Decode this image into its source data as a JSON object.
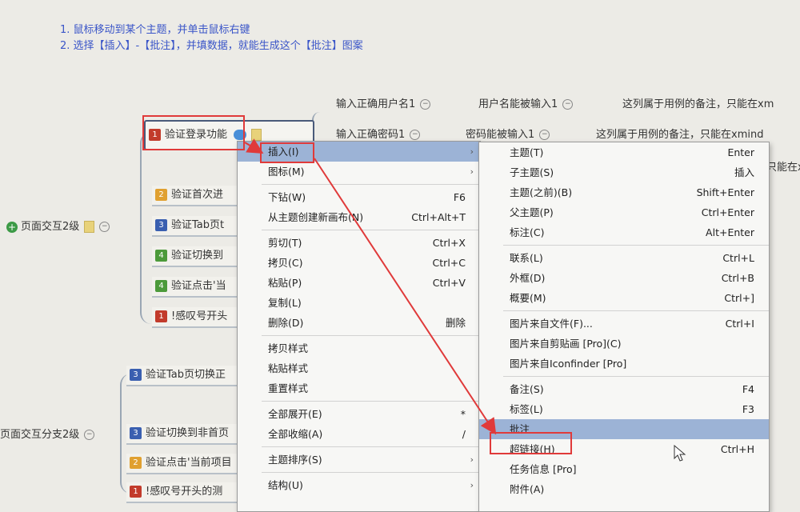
{
  "instructions": {
    "line1": "1. 鼠标移动到某个主题，并单击鼠标右键",
    "line2": "2. 选择【插入】-【批注】，并填数据，就能生成这个【批注】图案"
  },
  "mindmap": {
    "root1": "页面交互2级",
    "root2": "页面交互分支2级",
    "selected_topic": {
      "num": "1",
      "label": "验证登录功能"
    },
    "topics": [
      {
        "num": "2",
        "label": "验证首次进"
      },
      {
        "num": "3",
        "label": "验证Tab页t"
      },
      {
        "num": "4",
        "label": "验证切换到"
      },
      {
        "num": "4",
        "label": "验证点击'当"
      },
      {
        "num": "1",
        "label": "!感叹号开头"
      }
    ],
    "topics2": [
      {
        "num": "3",
        "label": "验证Tab页切换正"
      },
      {
        "num": "3",
        "label": "验证切换到非首页"
      },
      {
        "num": "2",
        "label": "验证点击'当前项目"
      },
      {
        "num": "1",
        "label": "!感叹号开头的测"
      }
    ],
    "subtopics": [
      {
        "a": "输入正确用户名1",
        "b": "用户名能被输入1",
        "c": "这列属于用例的备注，只能在xm"
      },
      {
        "a": "输入正确密码1",
        "b": "密码能被输入1",
        "c": "这列属于用例的备注，只能在xmind"
      }
    ],
    "partial_right": "只能在x"
  },
  "context_menu": [
    {
      "label": "插入(I)",
      "shortcut": "",
      "arrow": "›",
      "highlight": true
    },
    {
      "label": "图标(M)",
      "shortcut": "",
      "arrow": "›"
    },
    {
      "sep": true
    },
    {
      "label": "下钻(W)",
      "shortcut": "F6"
    },
    {
      "label": "从主题创建新画布(N)",
      "shortcut": "Ctrl+Alt+T"
    },
    {
      "sep": true
    },
    {
      "label": "剪切(T)",
      "shortcut": "Ctrl+X"
    },
    {
      "label": "拷贝(C)",
      "shortcut": "Ctrl+C"
    },
    {
      "label": "粘贴(P)",
      "shortcut": "Ctrl+V"
    },
    {
      "label": "复制(L)",
      "shortcut": ""
    },
    {
      "label": "删除(D)",
      "shortcut": "删除"
    },
    {
      "sep": true
    },
    {
      "label": "拷贝样式",
      "shortcut": ""
    },
    {
      "label": "粘贴样式",
      "shortcut": ""
    },
    {
      "label": "重置样式",
      "shortcut": ""
    },
    {
      "sep": true
    },
    {
      "label": "全部展开(E)",
      "shortcut": "*"
    },
    {
      "label": "全部收缩(A)",
      "shortcut": "/"
    },
    {
      "sep": true
    },
    {
      "label": "主题排序(S)",
      "shortcut": "",
      "arrow": "›"
    },
    {
      "sep": true
    },
    {
      "label": "结构(U)",
      "shortcut": "",
      "arrow": "›"
    }
  ],
  "submenu": [
    {
      "label": "主题(T)",
      "shortcut": "Enter"
    },
    {
      "label": "子主题(S)",
      "shortcut": "插入"
    },
    {
      "label": "主题(之前)(B)",
      "shortcut": "Shift+Enter"
    },
    {
      "label": "父主题(P)",
      "shortcut": "Ctrl+Enter"
    },
    {
      "label": "标注(C)",
      "shortcut": "Alt+Enter"
    },
    {
      "sep": true
    },
    {
      "label": "联系(L)",
      "shortcut": "Ctrl+L"
    },
    {
      "label": "外框(D)",
      "shortcut": "Ctrl+B"
    },
    {
      "label": "概要(M)",
      "shortcut": "Ctrl+]"
    },
    {
      "sep": true
    },
    {
      "label": "图片来自文件(F)...",
      "shortcut": "Ctrl+I"
    },
    {
      "label": "图片来自剪贴画 [Pro](C)",
      "shortcut": ""
    },
    {
      "label": "图片来自Iconfinder [Pro]",
      "shortcut": ""
    },
    {
      "sep": true
    },
    {
      "label": "备注(S)",
      "shortcut": "F4"
    },
    {
      "label": "标签(L)",
      "shortcut": "F3"
    },
    {
      "label": "批注",
      "shortcut": "",
      "highlight": true
    },
    {
      "label": "超链接(H)",
      "shortcut": "Ctrl+H"
    },
    {
      "label": "任务信息 [Pro]",
      "shortcut": ""
    },
    {
      "label": "附件(A)",
      "shortcut": ""
    }
  ],
  "colors": {
    "annotation_red": "#e03a3a",
    "highlight": "#9cb3d6",
    "instruction_blue": "#3a55c8"
  }
}
